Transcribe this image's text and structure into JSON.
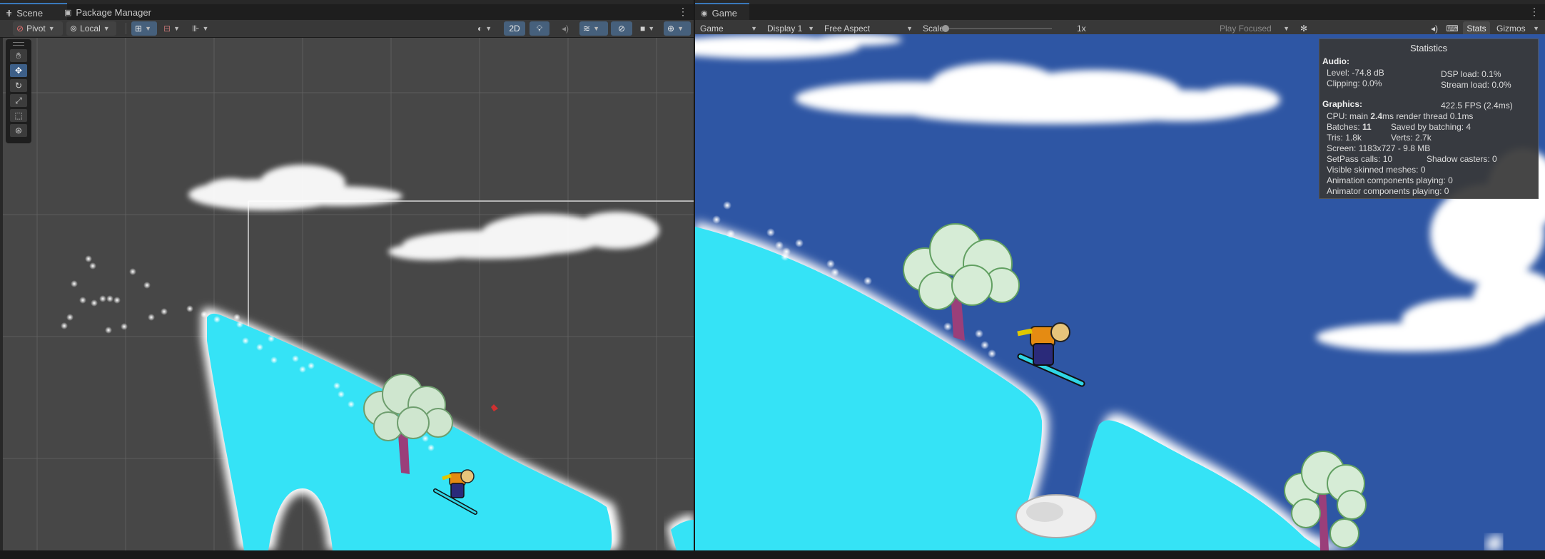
{
  "colors": {
    "accent": "#3a79bb",
    "sky": "#2e56a4",
    "snow": "#35e3f6",
    "scene_bg": "#474747"
  },
  "scene_panel": {
    "tabs": [
      {
        "label": "Scene",
        "icon": "grid-icon"
      },
      {
        "label": "Package Manager",
        "icon": "package-icon"
      }
    ],
    "toolbar": {
      "pivot": "Pivot",
      "local": "Local",
      "mode_2d": "2D"
    },
    "tools": [
      "hand-tool",
      "move-tool",
      "rotate-tool",
      "scale-tool",
      "rect-tool",
      "transform-tool"
    ]
  },
  "game_panel": {
    "tab": {
      "label": "Game",
      "icon": "gamepad-icon"
    },
    "toolbar": {
      "game": "Game",
      "display": "Display 1",
      "aspect": "Free Aspect",
      "scale_label": "Scale",
      "scale_value": "1x",
      "play_mode": "Play Focused",
      "stats": "Stats",
      "gizmos": "Gizmos"
    },
    "stats": {
      "title": "Statistics",
      "audio_header": "Audio:",
      "level": "Level: -74.8 dB",
      "clipping": "Clipping: 0.0%",
      "dsp": "DSP load: 0.1%",
      "stream": "Stream load: 0.0%",
      "graphics_header": "Graphics:",
      "fps": "422.5 FPS (2.4ms)",
      "cpu_prefix": "CPU: main ",
      "cpu_main": "2.4",
      "cpu_suffix": "ms  render thread 0.1ms",
      "batches_prefix": "Batches: ",
      "batches": "11",
      "saved": "Saved by batching: 4",
      "tris": "Tris: 1.8k",
      "verts": "Verts: 2.7k",
      "screen": "Screen: 1183x727 - 9.8 MB",
      "setpass": "SetPass calls: 10",
      "shadow": "Shadow casters: 0",
      "skinned": "Visible skinned meshes: 0",
      "animation": "Animation components playing: 0",
      "animator": "Animator components playing: 0"
    }
  }
}
